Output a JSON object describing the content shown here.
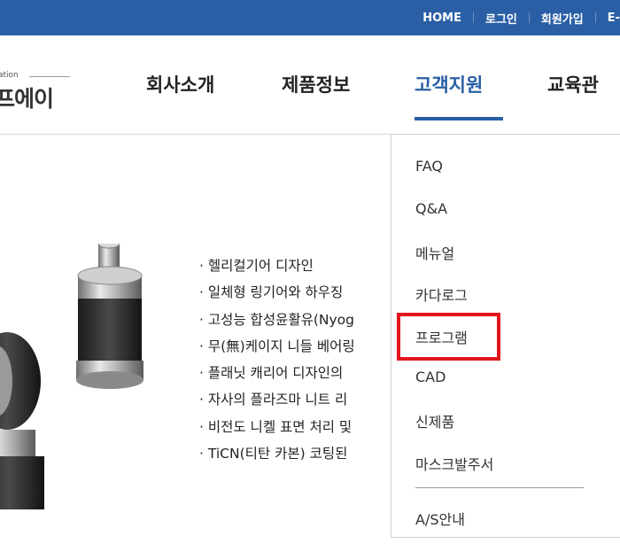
{
  "topbar": {
    "links": [
      "HOME",
      "로그인",
      "회원가입",
      "E-"
    ]
  },
  "logo": {
    "small_text": "ation",
    "main_text": "프에이"
  },
  "gnb": {
    "items": [
      "회사소개",
      "제품정보",
      "고객지원",
      "교육관"
    ],
    "active": "고객지원"
  },
  "features": [
    "· 헬리컬기어 디자인",
    "· 일체형 링기어와 하우징",
    "· 고성능 합성윤활유(Nyog",
    "· 무(無)케이지 니들 베어링",
    "· 플래닛 캐리어 디자인의",
    "· 자사의 플라즈마 니트 리",
    "· 비전도 니켈 표면 처리 및",
    "· TiCN(티탄 카본) 코팅된"
  ],
  "dropdown": {
    "items": [
      "FAQ",
      "Q&A",
      "메뉴얼",
      "카다로그",
      "프로그램",
      "CAD",
      "신제품",
      "마스크발주서",
      "A/S안내"
    ],
    "highlighted": "프로그램"
  },
  "colors": {
    "brand_blue": "#2a5fa6",
    "highlight_red": "#e4151c"
  }
}
